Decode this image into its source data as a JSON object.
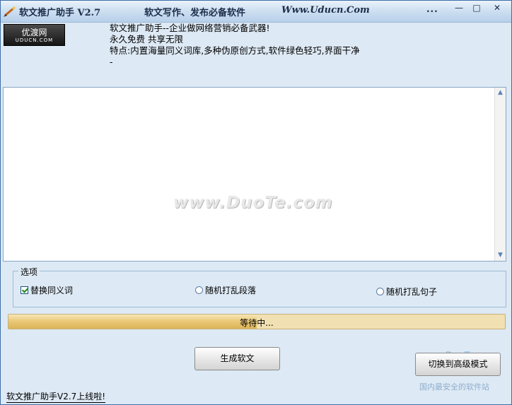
{
  "titlebar": {
    "app_name": "软文推广助手 V2.7",
    "slogan": "软文写作、发布必备软件",
    "website": "Www.Uducn.Com",
    "dots": "...",
    "minimize": "—",
    "maximize": "□",
    "close": "✕"
  },
  "logo": {
    "main": "优渡网",
    "sub": "UDUCN.COM"
  },
  "info_lines": [
    "软文推广助手--企业做网络营销必备武器!",
    "永久免费 共享无限",
    "特点:内置海量同义词库,多种伪原创方式,软件绿色轻巧,界面干净",
    "-"
  ],
  "editor": {
    "watermark": "www.DuoTe.com"
  },
  "options": {
    "title": "选项",
    "replace_synonyms": {
      "label": "替换同义词",
      "checked": true
    },
    "shuffle_paragraphs": {
      "label": "随机打乱段落",
      "checked": false
    },
    "shuffle_sentences": {
      "label": "随机打乱句子",
      "checked": false
    }
  },
  "progress": {
    "label": "等待中...",
    "value": 0.5
  },
  "buttons": {
    "generate": "生成软文",
    "advanced": "切换到高级模式"
  },
  "corner": {
    "brand": "DuoTe.com",
    "tagline": "国内最安全的软件站"
  },
  "status": {
    "text": "软文推广助手V2.7上线啦!"
  }
}
